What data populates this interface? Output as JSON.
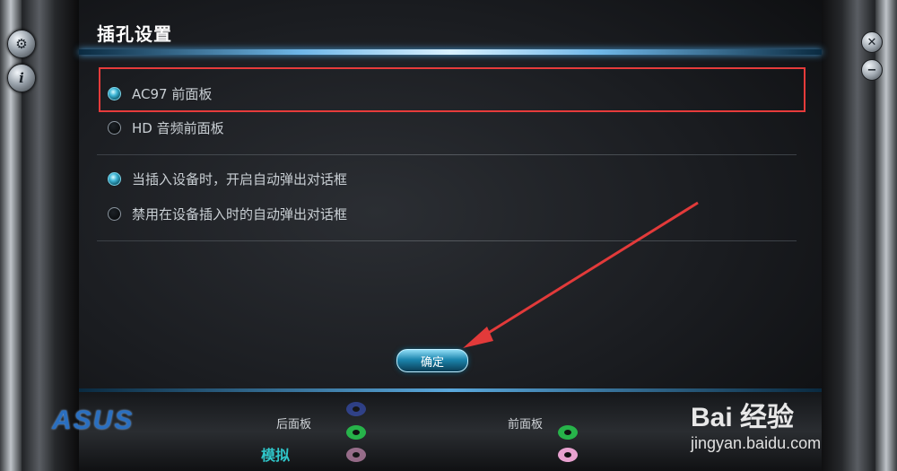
{
  "window": {
    "title": "插孔设置"
  },
  "panel_options": {
    "group1": [
      {
        "label": "AC97 前面板",
        "selected": true
      },
      {
        "label": "HD 音频前面板",
        "selected": false
      }
    ],
    "group2": [
      {
        "label": "当插入设备时，开启自动弹出对话框",
        "selected": true
      },
      {
        "label": "禁用在设备插入时的自动弹出对话框",
        "selected": false
      }
    ]
  },
  "buttons": {
    "ok_label": "确定"
  },
  "bottom_bar": {
    "brand": "ASUS",
    "rear_panel_label": "后面板",
    "front_panel_label": "前面板",
    "analog_label": "模拟"
  },
  "watermark": {
    "line1": "Bai 经验",
    "line2": "jingyan.baidu.com"
  },
  "colors": {
    "accent": "#3fb6d6",
    "highlight_box": "#e63b3b",
    "jack_blue": "#3b56c8",
    "jack_green": "#27b34a",
    "jack_pink": "#e8a1cf"
  }
}
